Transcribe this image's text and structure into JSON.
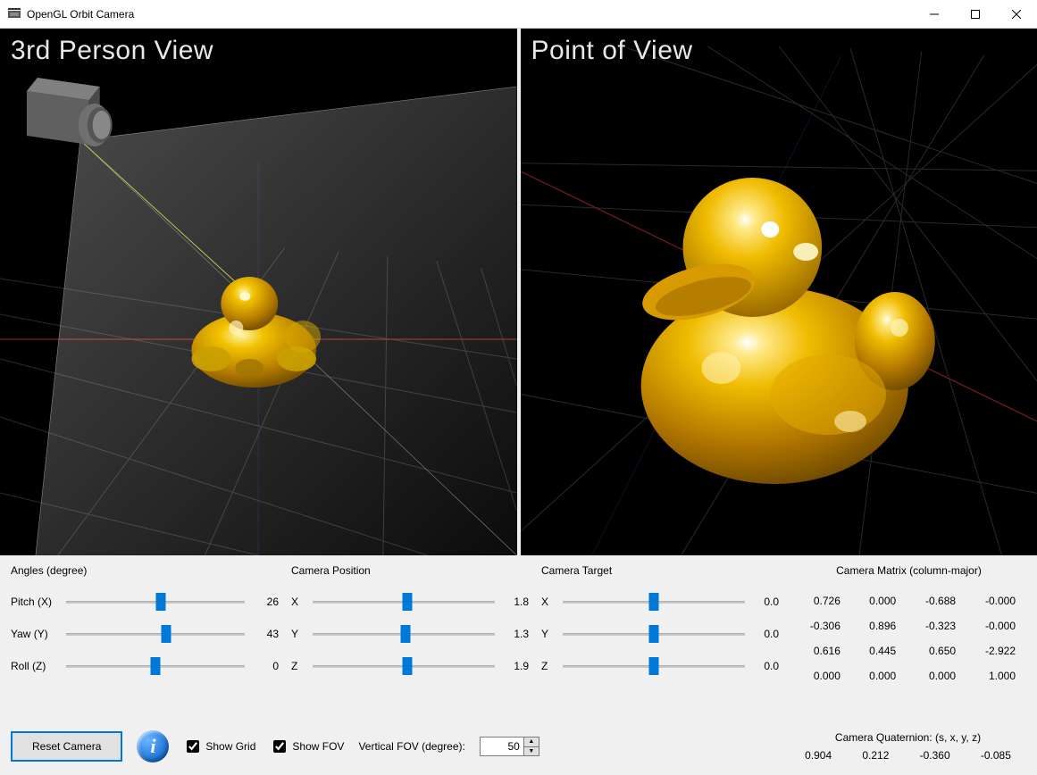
{
  "window": {
    "title": "OpenGL Orbit Camera"
  },
  "views": {
    "left_label": "3rd Person View",
    "right_label": "Point of View"
  },
  "angles": {
    "title": "Angles (degree)",
    "pitch": {
      "label": "Pitch (X)",
      "value": 26,
      "pct": 53
    },
    "yaw": {
      "label": "Yaw (Y)",
      "value": 43,
      "pct": 56
    },
    "roll": {
      "label": "Roll (Z)",
      "value": 0,
      "pct": 50
    }
  },
  "camera_position": {
    "title": "Camera Position",
    "x": {
      "label": "X",
      "value": "1.8",
      "pct": 52
    },
    "y": {
      "label": "Y",
      "value": "1.3",
      "pct": 51
    },
    "z": {
      "label": "Z",
      "value": "1.9",
      "pct": 52
    }
  },
  "camera_target": {
    "title": "Camera Target",
    "x": {
      "label": "X",
      "value": "0.0",
      "pct": 50
    },
    "y": {
      "label": "Y",
      "value": "0.0",
      "pct": 50
    },
    "z": {
      "label": "Z",
      "value": "0.0",
      "pct": 50
    }
  },
  "matrix": {
    "title": "Camera Matrix (column-major)",
    "rows": [
      [
        "0.726",
        "0.000",
        "-0.688",
        "-0.000"
      ],
      [
        "-0.306",
        "0.896",
        "-0.323",
        "-0.000"
      ],
      [
        "0.616",
        "0.445",
        "0.650",
        "-2.922"
      ],
      [
        "0.000",
        "0.000",
        "0.000",
        "1.000"
      ]
    ]
  },
  "bottom": {
    "reset_label": "Reset Camera",
    "show_grid_label": "Show Grid",
    "show_grid_checked": true,
    "show_fov_label": "Show FOV",
    "show_fov_checked": true,
    "fov_label": "Vertical FOV (degree):",
    "fov_value": "50"
  },
  "quaternion": {
    "title": "Camera Quaternion: (s, x, y, z)",
    "values": [
      "0.904",
      "0.212",
      "-0.360",
      "-0.085"
    ]
  }
}
